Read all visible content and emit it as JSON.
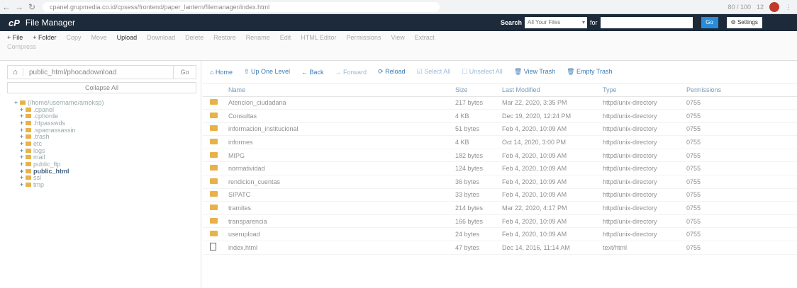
{
  "browser": {
    "url": "cpanel.grupmedia.co.id/cpsess/frontend/paper_lantern/filemanager/index.html",
    "right_1": "80 / 100",
    "right_2": "12"
  },
  "header": {
    "logo": "cP",
    "title": "File Manager",
    "search_label": "Search",
    "search_scope": "All Your Files",
    "for_label": "for",
    "go_label": "Go",
    "settings_label": "⚙ Settings"
  },
  "toolbar": {
    "items": [
      "+ File",
      "+ Folder",
      "Copy",
      "Move",
      "Upload",
      "Download",
      "Delete",
      "Restore",
      "Rename",
      "Edit",
      "HTML Editor",
      "Permissions",
      "View",
      "Extract"
    ],
    "row2": "Compress"
  },
  "sidebar": {
    "path": "public_html/phocadownload",
    "go_label": "Go",
    "collapse_label": "Collapse All",
    "tree": [
      {
        "label": "(/home/username/amoksp)",
        "level": 0,
        "bold": false
      },
      {
        "label": ".cpanel",
        "level": 1,
        "bold": false
      },
      {
        "label": ".cphorde",
        "level": 1,
        "bold": false
      },
      {
        "label": ".htpasswds",
        "level": 1,
        "bold": false
      },
      {
        "label": ".spamassassin",
        "level": 1,
        "bold": false
      },
      {
        "label": ".trash",
        "level": 1,
        "bold": false
      },
      {
        "label": "etc",
        "level": 1,
        "bold": false
      },
      {
        "label": "logs",
        "level": 1,
        "bold": false
      },
      {
        "label": "mail",
        "level": 1,
        "bold": false
      },
      {
        "label": "public_ftp",
        "level": 1,
        "bold": false
      },
      {
        "label": "public_html",
        "level": 1,
        "bold": true
      },
      {
        "label": "ssl",
        "level": 1,
        "bold": false
      },
      {
        "label": "tmp",
        "level": 1,
        "bold": false
      }
    ]
  },
  "actions": [
    "⌂ Home",
    "⇧ Up One Level",
    "← Back",
    "→ Forward",
    "⟳ Reload",
    "☑ Select All",
    "☐ Unselect All",
    "🗑 View Trash",
    "🗑 Empty Trash"
  ],
  "table": {
    "headers": [
      "Name",
      "Size",
      "Last Modified",
      "Type",
      "Permissions"
    ],
    "rows": [
      {
        "icon": "folder",
        "name": "Atencion_ciudadana",
        "size": "217 bytes",
        "modified": "Mar 22, 2020, 3:35 PM",
        "type": "httpd/unix-directory",
        "perm": "0755"
      },
      {
        "icon": "folder",
        "name": "Consultas",
        "size": "4 KB",
        "modified": "Dec 19, 2020, 12:24 PM",
        "type": "httpd/unix-directory",
        "perm": "0755"
      },
      {
        "icon": "folder",
        "name": "informacion_institucional",
        "size": "51 bytes",
        "modified": "Feb 4, 2020, 10:09 AM",
        "type": "httpd/unix-directory",
        "perm": "0755"
      },
      {
        "icon": "folder",
        "name": "informes",
        "size": "4 KB",
        "modified": "Oct 14, 2020, 3:00 PM",
        "type": "httpd/unix-directory",
        "perm": "0755"
      },
      {
        "icon": "folder",
        "name": "MIPG",
        "size": "182 bytes",
        "modified": "Feb 4, 2020, 10:09 AM",
        "type": "httpd/unix-directory",
        "perm": "0755"
      },
      {
        "icon": "folder",
        "name": "normatividad",
        "size": "124 bytes",
        "modified": "Feb 4, 2020, 10:09 AM",
        "type": "httpd/unix-directory",
        "perm": "0755"
      },
      {
        "icon": "folder",
        "name": "rendicion_cuentas",
        "size": "36 bytes",
        "modified": "Feb 4, 2020, 10:09 AM",
        "type": "httpd/unix-directory",
        "perm": "0755"
      },
      {
        "icon": "folder",
        "name": "SIPATC",
        "size": "33 bytes",
        "modified": "Feb 4, 2020, 10:09 AM",
        "type": "httpd/unix-directory",
        "perm": "0755"
      },
      {
        "icon": "folder",
        "name": "tramites",
        "size": "214 bytes",
        "modified": "Mar 22, 2020, 4:17 PM",
        "type": "httpd/unix-directory",
        "perm": "0755"
      },
      {
        "icon": "folder",
        "name": "transparencia",
        "size": "166 bytes",
        "modified": "Feb 4, 2020, 10:09 AM",
        "type": "httpd/unix-directory",
        "perm": "0755"
      },
      {
        "icon": "folder",
        "name": "userupload",
        "size": "24 bytes",
        "modified": "Feb 4, 2020, 10:09 AM",
        "type": "httpd/unix-directory",
        "perm": "0755"
      },
      {
        "icon": "file",
        "name": "index.html",
        "size": "47 bytes",
        "modified": "Dec 14, 2016, 11:14 AM",
        "type": "text/html",
        "perm": "0755"
      }
    ]
  }
}
